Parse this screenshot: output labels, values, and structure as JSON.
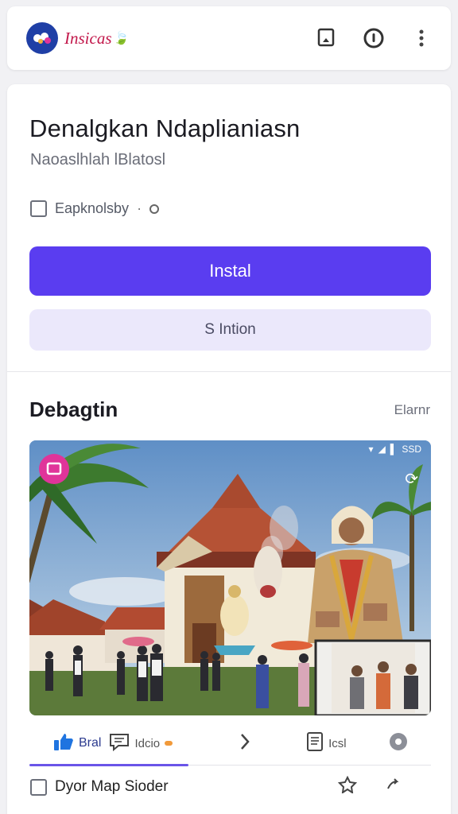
{
  "header": {
    "logo_text": "Insicas",
    "icons": [
      "bookmark-icon",
      "clock-icon",
      "more-vert-icon"
    ]
  },
  "card": {
    "title": "Denalgkan Ndaplianiasn",
    "subtitle": "Naoaslhlah lBlatosl",
    "meta_label": "Eapknolsby",
    "meta_separator": "·",
    "install_label": "Instal",
    "secondary_label": "S Intion"
  },
  "section": {
    "title": "Debagtin",
    "link_label": "Elarnr"
  },
  "media": {
    "status_text": "SSD"
  },
  "actions": {
    "first_label": "Bral",
    "second_label": "Idcio",
    "fourth_label": "Icsl"
  },
  "bottom": {
    "label": "Dyor Map Sioder"
  },
  "colors": {
    "primary": "#5a3df0",
    "secondary_bg": "#ebe8fb",
    "logo_blue": "#1f3fa6",
    "logo_red": "#c2184b",
    "badge_pink": "#e0349a"
  }
}
